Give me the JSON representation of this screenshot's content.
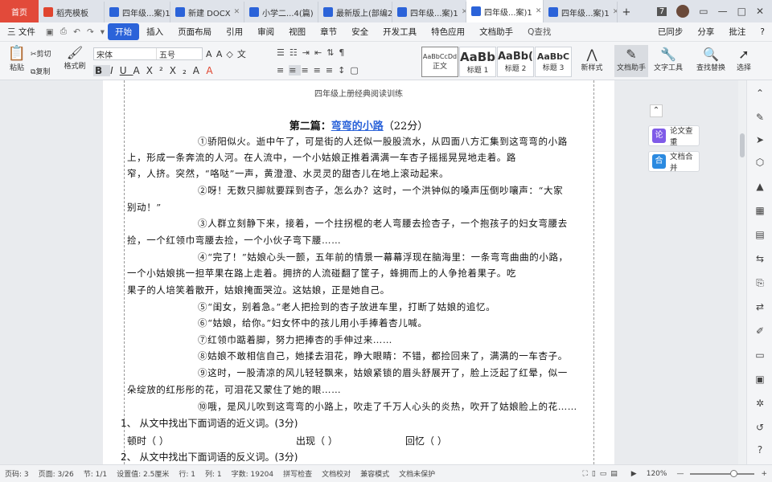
{
  "tabs": [
    {
      "label": "首页",
      "kind": "home"
    },
    {
      "label": "稻壳模板",
      "kind": "docer"
    },
    {
      "label": "四年级...案)1",
      "kind": "w"
    },
    {
      "label": "新建 DOCX",
      "kind": "w"
    },
    {
      "label": "小学二...4(篇)",
      "kind": "w"
    },
    {
      "label": "最新版上(部编2",
      "kind": "w"
    },
    {
      "label": "四年级...案)1",
      "kind": "w"
    },
    {
      "label": "四年级...案)1",
      "kind": "w",
      "active": true
    },
    {
      "label": "四年级...案)1",
      "kind": "w"
    }
  ],
  "tabbar": {
    "add": "+",
    "count": "7"
  },
  "menu": {
    "file": "三 文件",
    "items": [
      "开始",
      "插入",
      "页面布局",
      "引用",
      "审阅",
      "视图",
      "章节",
      "安全",
      "开发工具",
      "特色应用",
      "文档助手"
    ],
    "active": "开始",
    "search": "Q查找",
    "right": [
      "已同步",
      "分享",
      "批注",
      "?"
    ]
  },
  "ribbon": {
    "paste": "粘贴",
    "cut": "剪切",
    "copy": "复制",
    "format_painter": "格式刷",
    "font_name": "宋体",
    "font_size": "五号",
    "styles": [
      {
        "preview": "AaBbCcDd",
        "label": "正文"
      },
      {
        "preview": "AaBb",
        "label": "标题 1"
      },
      {
        "preview": "AaBb(",
        "label": "标题 2"
      },
      {
        "preview": "AaBbC",
        "label": "标题 3"
      }
    ],
    "new_style": "新样式",
    "doc_assistant": "文档助手",
    "text_tools": "文字工具",
    "find_replace": "查找替换",
    "select": "选择"
  },
  "document": {
    "header": "四年级上册经典阅读训练",
    "heading_prefix": "第二篇：",
    "heading_link": "弯弯的小路",
    "heading_score": "（22分）",
    "lines": [
      "①骄阳似火。逝中午了，可是街的人还似一股股流水，从四面八方汇集到这弯弯的小路",
      "上，形成一条奔流的人河。在人流中，一个小姑娘正推着满满一车杏子摇摇晃晃地走着。路",
      "窄，人挤。突然，“咯哒”一声，黄澄澄、水灵灵的甜杏儿在地上滚动起来。",
      "②呀！无数只脚就要踩到杏子，怎么办？这时，一个洪钟似的嗓声压倒吵嚷声：“大家",
      "别动！”",
      "③人群立刻静下来，接着，一个拄拐棍的老人弯腰去捡杏子，一个抱孩子的妇女弯腰去",
      "捡，一个红领巾弯腰去捡，一个小伙子弯下腰……",
      "④“完了！”姑娘心头一颤，五年前的情景一幕幕浮现在脑海里：一条弯弯曲曲的小路，",
      "一个小姑娘挑一担苹果在路上走着。拥挤的人流碰翻了筐子，蜂拥而上的人争抢着果子。吃",
      "果子的人培笑着散开，姑娘掩面哭泣。这姑娘，正是她自己。",
      "⑤“闺女，别着急。”老人把捡到的杏子放进车里，打断了姑娘的追忆。",
      "⑥“姑娘，给你。”妇女怀中的孩儿用小手捧着杏儿喊。",
      "⑦红领巾踮着脚，努力把捧杏的手伸过来……",
      "⑧姑娘不敢相信自己，她揉去泪花，睁大眼睛：不错，都捡回来了，满满的一车杏子。",
      "⑨这时，一股清凉的风儿轻轻飘来，姑娘紧锁的眉头舒展开了，脸上泛起了红晕，似一",
      "朵绽放的红彤彤的花，可泪花又蒙住了她的眼……",
      "⑩哦，是风儿吹到这弯弯的小路上，吹走了千万人心头的炎热，吹开了姑娘脸上的花……"
    ],
    "q1": "1、  从文中找出下面词语的近义词。(3分)",
    "q1_items": [
      "顿时（            ）",
      "出现（            ）",
      "回忆（            ）"
    ],
    "q2": "2、  从文中找出下面词语的反义词。(3分)"
  },
  "side_panel": {
    "btn1": "论文查重",
    "btn2": "文档合并"
  },
  "status": {
    "page_no": "页码: 3",
    "pages": "页面: 3/26",
    "section": "节: 1/1",
    "position": "设置值: 2.5厘米",
    "row": "行: 1",
    "col": "列: 1",
    "words": "字数: 19204",
    "spell": "拼写检查",
    "proof": "文档校对",
    "compat": "兼容模式",
    "protect": "文档未保护",
    "zoom": "120%"
  },
  "colors": {
    "accent": "#2b63d9",
    "home_tab": "#e24a3a",
    "link": "#2b63d9"
  }
}
